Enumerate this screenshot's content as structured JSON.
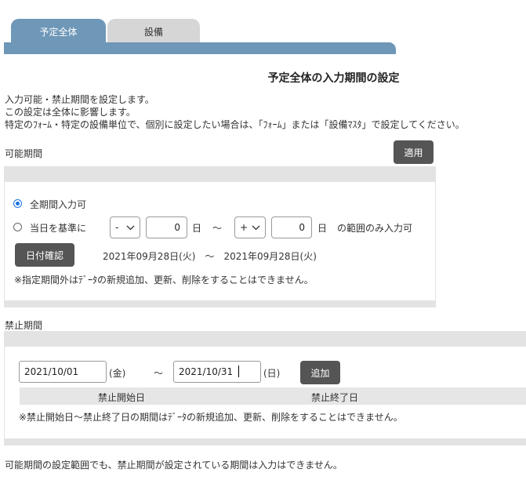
{
  "tabs": [
    {
      "label": "予定全体",
      "active": true
    },
    {
      "label": "設備",
      "active": false
    }
  ],
  "page_title": "予定全体の入力期間の設定",
  "description": [
    "入力可能・禁止期間を設定します。",
    "この設定は全体に影響します。",
    "特定のﾌｫｰﾑ・特定の設備単位で、個別に設定したい場合は、「ﾌｫｰﾑ」または「設備ﾏｽﾀ」で設定してください。"
  ],
  "available_period": {
    "label": "可能期間",
    "apply_button": "適用",
    "option_all": "全期間入力可",
    "option_relative": "当日を基準に",
    "start_sign": "-",
    "start_days": "0",
    "day_unit": "日",
    "tilde": "～",
    "end_sign": "+",
    "end_days": "0",
    "range_suffix": "の範囲のみ入力可",
    "check_date_button": "日付確認",
    "date_range_text": "2021年09月28日(火)　～　2021年09月28日(火)",
    "note": "※指定期間外はﾃﾞｰﾀの新規追加、更新、削除をすることはできません。"
  },
  "prohibited_period": {
    "label": "禁止期間",
    "start_date": "2021/10/01",
    "start_weekday": "(金)",
    "tilde": "～",
    "end_date": "2021/10/31",
    "end_weekday": "(日)",
    "add_button": "追加",
    "col_start": "禁止開始日",
    "col_end": "禁止終了日",
    "note": "※禁止開始日～禁止終了日の期間はﾃﾞｰﾀの新規追加、更新、削除をすることはできません。"
  },
  "footer_note": "可能期間の設定範囲でも、禁止期間が設定されている期間は入力はできません。",
  "colors": {
    "tab_active": "#6e97b8",
    "tab_inactive": "#d6d6d6",
    "button_dark": "#555555",
    "radio_accent": "#1a73e8"
  }
}
